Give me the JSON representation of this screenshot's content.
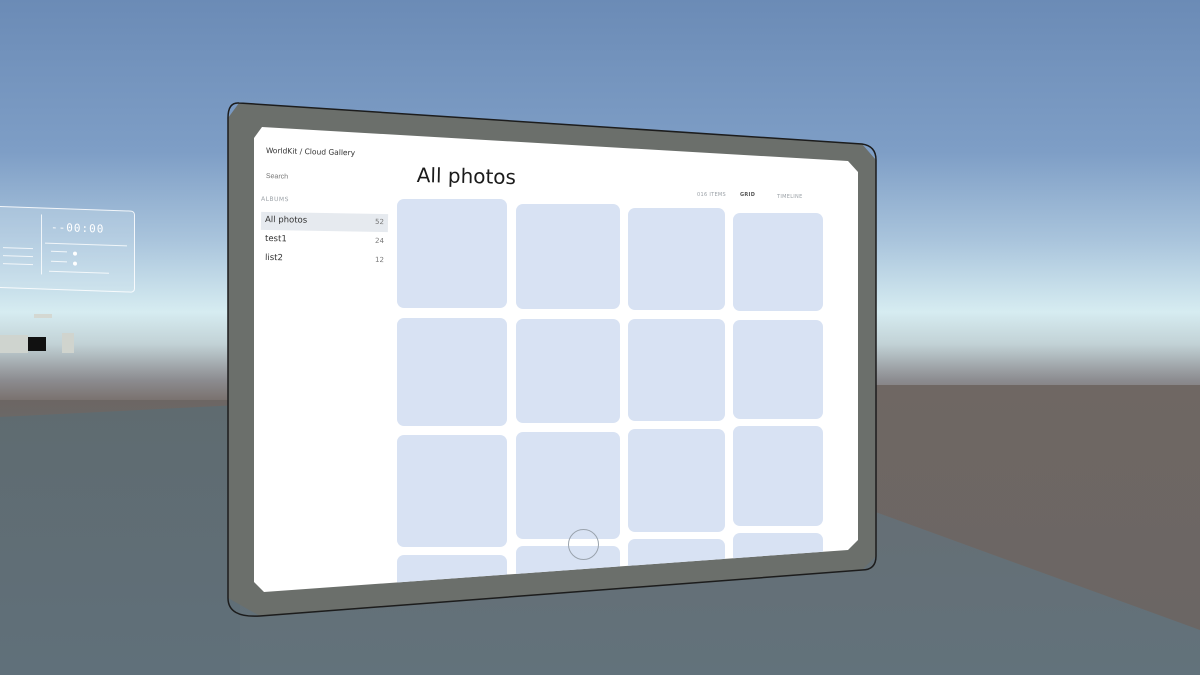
{
  "app": {
    "breadcrumb": "WorldKit / Cloud Gallery"
  },
  "sidebar": {
    "search_placeholder": "Search",
    "albums_label": "ALBUMS",
    "items": [
      {
        "label": "All photos",
        "count": "52",
        "active": true
      },
      {
        "label": "test1",
        "count": "24",
        "active": false
      },
      {
        "label": "list2",
        "count": "12",
        "active": false
      }
    ]
  },
  "main": {
    "title": "All photos",
    "item_count": "016 ITEMS",
    "views": [
      {
        "label": "GRID",
        "active": true
      },
      {
        "label": "TIMELINE",
        "active": false
      }
    ]
  },
  "hud": {
    "time": "--00:00"
  },
  "colors": {
    "tile": "#d8e2f3",
    "active_row": "#e6eaef",
    "bezel": "#6b6f6b"
  }
}
